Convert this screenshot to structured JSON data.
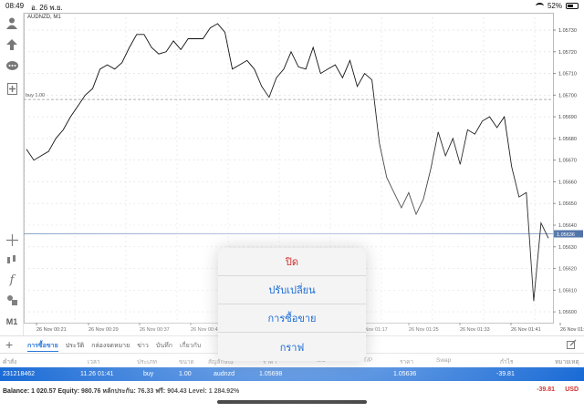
{
  "status": {
    "time": "08:49",
    "date": "อ. 26 พ.ย.",
    "battery": "52%",
    "battery_level": 0.52
  },
  "toolbar_icons": [
    "person-icon",
    "trade-arrows-icon",
    "chat-icon",
    "new-order-icon",
    "crosshair-icon",
    "indicator-icon",
    "function-icon",
    "objects-icon",
    "timeframe-icon"
  ],
  "timeframe_label": "M1",
  "chart": {
    "symbol_label": "AUDNZD, M1",
    "buy_label": "buy 1.00",
    "current_price_label": "1.05636",
    "colors": {
      "line": "#111111",
      "grid": "#d9d9d9",
      "buy_line": "#9a9a9a",
      "price_line": "#5b7fb3",
      "price_tag": "#4a6fa5"
    }
  },
  "chart_data": {
    "type": "line",
    "title": "AUDNZD, M1",
    "x_tick_labels": [
      "26 Nov 00:21",
      "26 Nov 00:29",
      "26 Nov 00:37",
      "26 Nov 00:45",
      "26 Nov 01:17",
      "26 Nov 01:25",
      "26 Nov 01:33",
      "26 Nov 01:41",
      "26 Nov 01:49"
    ],
    "y_tick_labels": [
      "1.05600",
      "1.05610",
      "1.05620",
      "1.05630",
      "1.05640",
      "1.05650",
      "1.05660",
      "1.05670",
      "1.05680",
      "1.05690",
      "1.05700",
      "1.05710",
      "1.05720",
      "1.05730"
    ],
    "ylim": [
      1.05595,
      1.05738
    ],
    "buy_level": 1.05698,
    "current_price": 1.05636,
    "values": [
      1.05675,
      1.0567,
      1.05672,
      1.05674,
      1.0568,
      1.05684,
      1.0569,
      1.05695,
      1.057,
      1.05703,
      1.05712,
      1.05714,
      1.05712,
      1.05715,
      1.05722,
      1.05728,
      1.05728,
      1.05722,
      1.05719,
      1.0572,
      1.05725,
      1.05721,
      1.05726,
      1.05726,
      1.05726,
      1.05731,
      1.05733,
      1.05729,
      1.05712,
      1.05714,
      1.05716,
      1.05712,
      1.05704,
      1.05699,
      1.05708,
      1.05712,
      1.0572,
      1.05713,
      1.05712,
      1.05722,
      1.0571,
      1.05712,
      1.05714,
      1.05708,
      1.05716,
      1.05704,
      1.0571,
      1.05707,
      1.05678,
      1.05662,
      1.05655,
      1.05648,
      1.05655,
      1.05645,
      1.05652,
      1.05666,
      1.05683,
      1.05672,
      1.0568,
      1.05668,
      1.05684,
      1.05682,
      1.05688,
      1.0569,
      1.05685,
      1.0569,
      1.05667,
      1.05653,
      1.05655,
      1.05605,
      1.05641,
      1.05634
    ]
  },
  "tabs": [
    "การซื้อขาย",
    "ประวัติ",
    "กล่องจดหมาย",
    "ข่าว",
    "บันทึก",
    "เกี่ยวกับ"
  ],
  "active_tab": "การซื้อขาย",
  "columns": [
    "คำสั่ง",
    "เวลา",
    "ประเภท",
    "ขนาด",
    "สัญลักษณ์",
    "ราคา",
    "S/L",
    "T/P",
    "ราคา",
    "Swap",
    "กำไร",
    "หมายเหตุ"
  ],
  "order": {
    "ticket": "231218462",
    "time": "11.26 01:41",
    "type": "buy",
    "size": "1.00",
    "symbol": "audnzd",
    "open_price": "1.05698",
    "current_price": "1.05636",
    "profit": "-39.81"
  },
  "balance_line": "Balance: 1 020.57 Equity: 980.76 หลักประกัน: 76.33 ฟรี: 904.43 Level: 1 284.92%",
  "total_profit": "-39.81",
  "currency": "USD",
  "popup": {
    "close": "ปิด",
    "modify": "ปรับเปลี่ยน",
    "trade": "การซื้อขาย",
    "chart": "กราฟ"
  }
}
